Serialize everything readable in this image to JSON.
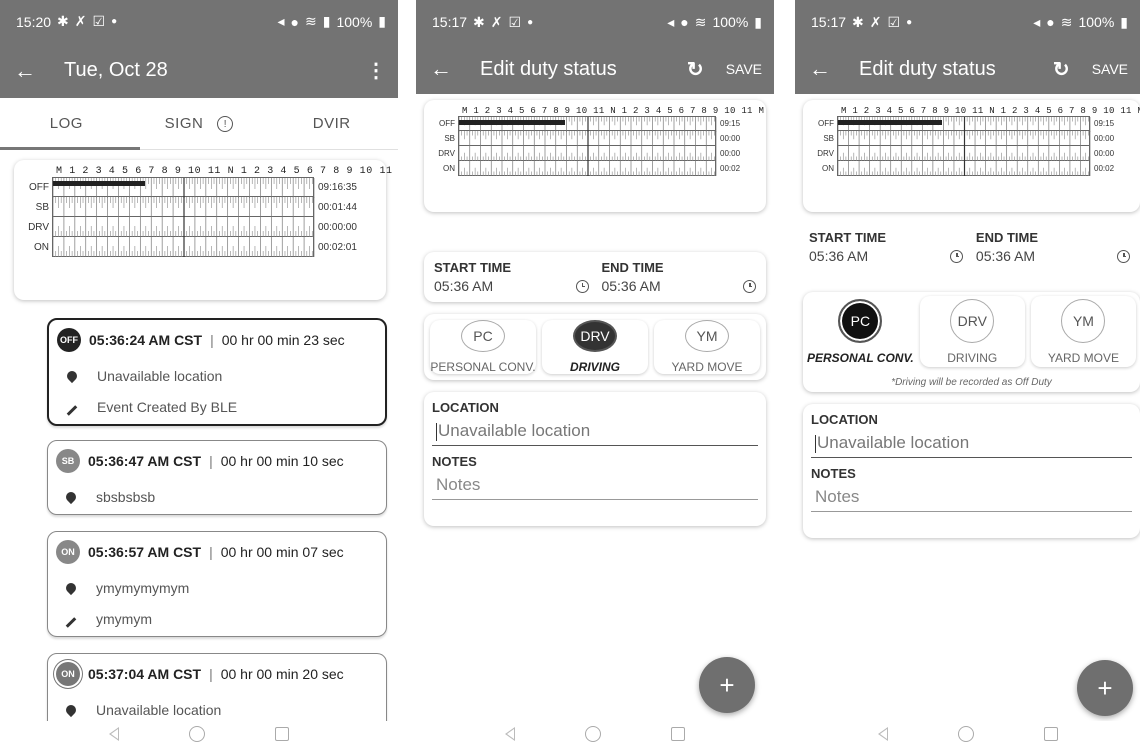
{
  "hours_header": "M 1 2 3 4 5 6 7 8 9 10 11 N 1 2 3 4 5 6 7 8 9 10 11 M",
  "screen1": {
    "status_time": "15:20",
    "status_battery": "100%",
    "title": "Tue, Oct 28",
    "tabs": [
      "LOG",
      "SIGN",
      "DVIR"
    ],
    "grid": {
      "rows": [
        "OFF",
        "SB",
        "DRV",
        "ON"
      ],
      "totals": [
        "09:16:35",
        "00:01:44",
        "00:00:00",
        "00:02:01"
      ]
    },
    "events": [
      {
        "badge": "OFF",
        "time": "05:36:24 AM CST",
        "duration": "00 hr 00 min 23 sec",
        "location": "Unavailable location",
        "note": "Event Created By BLE"
      },
      {
        "badge": "SB",
        "time": "05:36:47 AM CST",
        "duration": "00 hr 00 min 10 sec",
        "location": "sbsbsbsb"
      },
      {
        "badge": "ON",
        "time": "05:36:57 AM CST",
        "duration": "00 hr 00 min 07 sec",
        "location": "ymymymymym",
        "note": "ymymym"
      },
      {
        "badge": "ON",
        "time": "05:37:04 AM CST",
        "duration": "00 hr 00 min 20 sec",
        "location": "Unavailable location"
      }
    ]
  },
  "screen2": {
    "status_time": "15:17",
    "status_battery": "100%",
    "title": "Edit duty status",
    "save": "SAVE",
    "grid": {
      "rows": [
        "OFF",
        "SB",
        "DRV",
        "ON"
      ],
      "totals": [
        "09:15",
        "00:00",
        "00:00",
        "00:02"
      ]
    },
    "start_label": "START TIME",
    "start_value": "05:36 AM",
    "end_label": "END TIME",
    "end_value": "05:36 AM",
    "statuses": [
      {
        "code": "PC",
        "label": "PERSONAL CONV."
      },
      {
        "code": "DRV",
        "label": "DRIVING"
      },
      {
        "code": "YM",
        "label": "YARD MOVE"
      }
    ],
    "location_label": "LOCATION",
    "location_placeholder": "Unavailable location",
    "notes_label": "NOTES",
    "notes_placeholder": "Notes",
    "fab": "+"
  },
  "screen3": {
    "status_time": "15:17",
    "status_battery": "100%",
    "title": "Edit duty status",
    "save": "SAVE",
    "grid": {
      "rows": [
        "OFF",
        "SB",
        "DRV",
        "ON"
      ],
      "totals": [
        "09:15",
        "00:00",
        "00:00",
        "00:02"
      ]
    },
    "start_label": "START TIME",
    "start_value": "05:36 AM",
    "end_label": "END TIME",
    "end_value": "05:36 AM",
    "statuses": [
      {
        "code": "PC",
        "label": "PERSONAL CONV."
      },
      {
        "code": "DRV",
        "label": "DRIVING"
      },
      {
        "code": "YM",
        "label": "YARD MOVE"
      }
    ],
    "pc_note": "*Driving will be recorded as Off Duty",
    "location_label": "LOCATION",
    "location_placeholder": "Unavailable location",
    "notes_label": "NOTES",
    "notes_placeholder": "Notes",
    "fab": "+"
  }
}
